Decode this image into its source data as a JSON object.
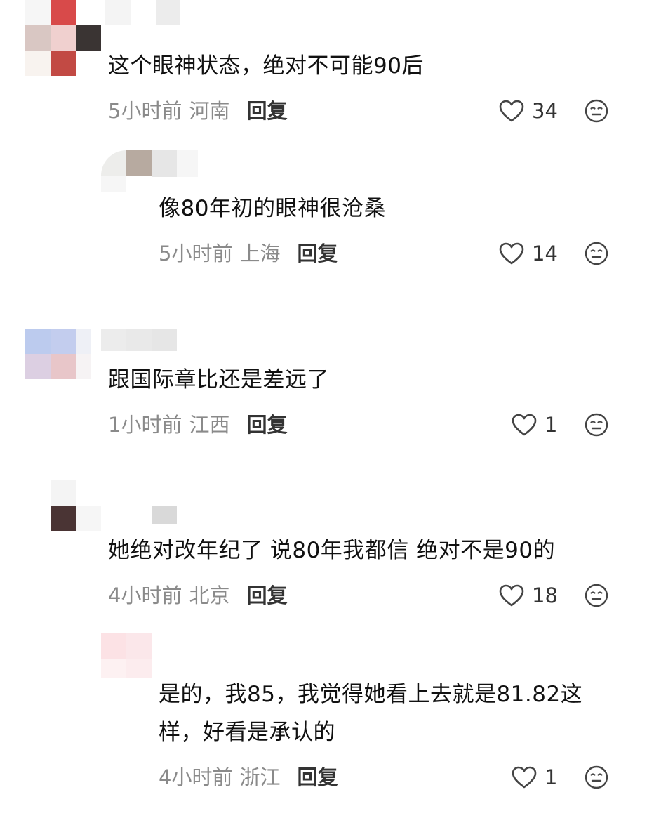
{
  "comments": [
    {
      "text": "这个眼神状态，绝对不可能90后",
      "time": "5小时前",
      "location": "河南",
      "reply": "回复",
      "likes": "34",
      "is_reply": false,
      "avatar_colors": [
        "#f4f4f4",
        "#d84a4a",
        "#f0d0cf",
        "#3a3433",
        "#c24a44",
        "#f8f3ef"
      ]
    },
    {
      "text": "像80年初的眼神很沧桑",
      "time": "5小时前",
      "location": "上海",
      "reply": "回复",
      "likes": "14",
      "is_reply": true,
      "avatar_colors": [
        "#e9e7e6",
        "#b7aaa0",
        "#d9d6d4",
        "#f4f4f4",
        "#ffffff",
        "#ffffff"
      ]
    },
    {
      "text": "跟国际章比还是差远了",
      "time": "1小时前",
      "location": "江西",
      "reply": "回复",
      "likes": "1",
      "is_reply": false,
      "avatar_colors": [
        "#b8c9ee",
        "#e9eaf3",
        "#d7c3d9",
        "#e6c3c7",
        "#ffffff",
        "#ffffff"
      ]
    },
    {
      "text": "她绝对改年纪了 说80年我都信 绝对不是90的",
      "time": "4小时前",
      "location": "北京",
      "reply": "回复",
      "likes": "18",
      "is_reply": false,
      "avatar_colors": [
        "#ffffff",
        "#f4f4f4",
        "#4a3434",
        "#f8f8f8",
        "#ffffff",
        "#ffffff"
      ]
    },
    {
      "text_lines": [
        "是的，我85，我觉得她看上去就是81.82这",
        "样，好看是承认的"
      ],
      "time": "4小时前",
      "location": "浙江",
      "reply": "回复",
      "likes": "1",
      "is_reply": true,
      "avatar_colors": [
        "#fbe3e6",
        "#fbe9eb",
        "#fdf2f3",
        "#fcecee",
        "#ffffff",
        "#ffffff"
      ]
    }
  ],
  "icons": {
    "like": "heart-outline-icon",
    "emoji": "neutral-face-icon"
  },
  "colors": {
    "text": "#111111",
    "meta": "#8a8a8a",
    "reply": "#333333"
  }
}
